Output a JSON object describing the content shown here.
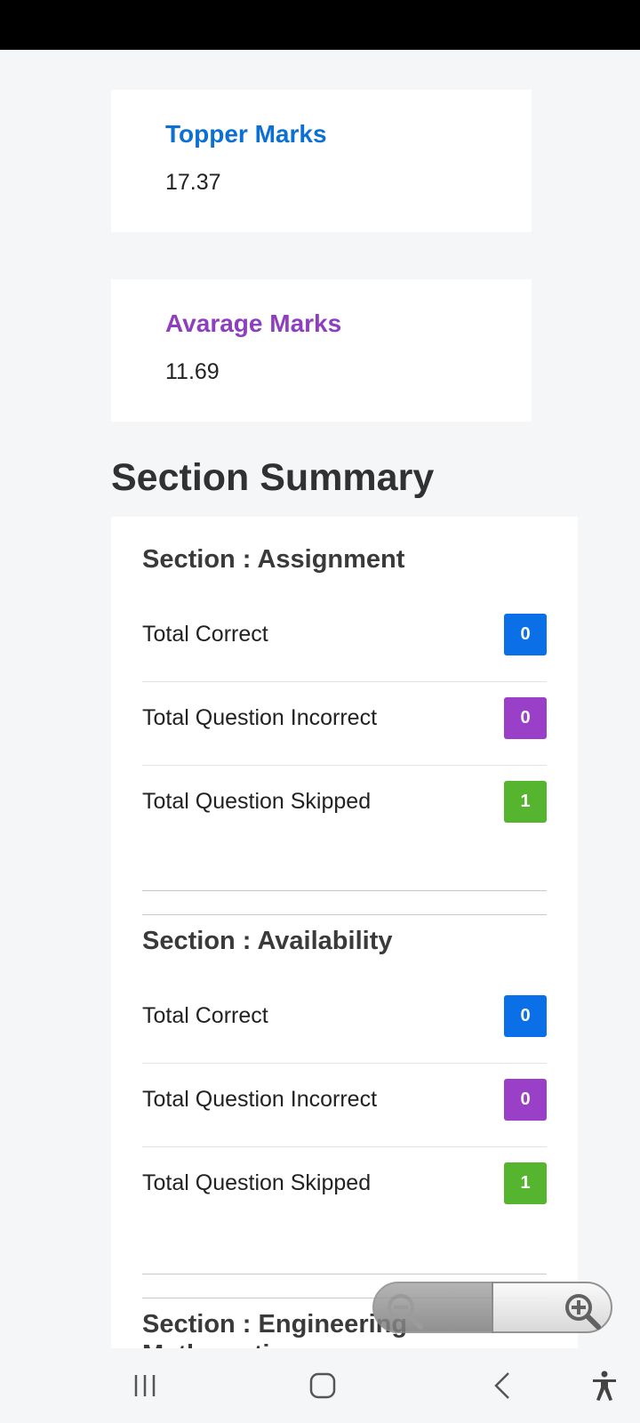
{
  "topper": {
    "title": "Topper Marks",
    "value": "17.37"
  },
  "average": {
    "title": "Avarage Marks",
    "value": "11.69"
  },
  "summary_title": "Section Summary",
  "sections": [
    {
      "title": "Section : Assignment",
      "rows": [
        {
          "label": "Total Correct",
          "value": "0",
          "color": "#0b6fe8"
        },
        {
          "label": "Total Question Incorrect",
          "value": "0",
          "color": "#9a3fc8"
        },
        {
          "label": "Total Question Skipped",
          "value": "1",
          "color": "#56b52f"
        }
      ]
    },
    {
      "title": "Section : Availability",
      "rows": [
        {
          "label": "Total Correct",
          "value": "0",
          "color": "#0b6fe8"
        },
        {
          "label": "Total Question Incorrect",
          "value": "0",
          "color": "#9a3fc8"
        },
        {
          "label": "Total Question Skipped",
          "value": "1",
          "color": "#56b52f"
        }
      ]
    },
    {
      "title": "Section : Engineering Mathematics"
    }
  ],
  "zoom": {
    "out_icon": "zoom-out-icon",
    "in_icon": "zoom-in-icon"
  },
  "navbar": {
    "icons": [
      "recent-apps-icon",
      "home-icon",
      "back-icon",
      "accessibility-icon"
    ]
  }
}
